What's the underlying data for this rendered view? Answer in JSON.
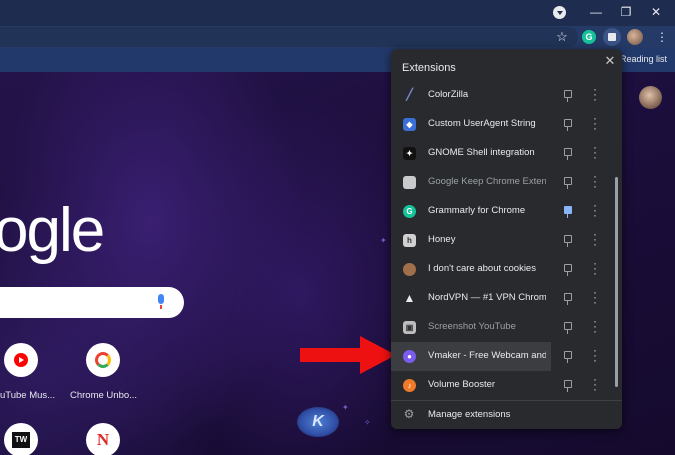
{
  "browser": {
    "window_controls": {
      "minimize": "—",
      "restore": "❐",
      "close": "✕"
    },
    "toolbar": {
      "bookmark_star": "☆",
      "menu": "⋮"
    },
    "extension_button_letter": "G",
    "bookmarks_bar": {
      "reading_list": "Reading list"
    }
  },
  "new_tab_page": {
    "logo_text": "ogle",
    "shortcuts": [
      {
        "label": "uTube Mus...",
        "icon": "youtube-music-icon"
      },
      {
        "label": "Chrome Unbo...",
        "icon": "chrome-icon"
      },
      {
        "label": "",
        "icon": "tw-icon",
        "text": "TW"
      },
      {
        "label": "",
        "icon": "news-icon",
        "text": "N"
      }
    ]
  },
  "extensions_popup": {
    "title": "Extensions",
    "close_icon": "✕",
    "items": [
      {
        "name": "ColorZilla",
        "icon": "colorzilla-icon",
        "icon_color": "#7a8ad6",
        "pinned": false,
        "dim": false
      },
      {
        "name": "Custom UserAgent String",
        "icon": "useragent-icon",
        "icon_color": "#3b6fd8",
        "pinned": false,
        "dim": false
      },
      {
        "name": "GNOME Shell integration",
        "icon": "gnome-icon",
        "icon_color": "#111111",
        "pinned": false,
        "dim": false
      },
      {
        "name": "Google Keep Chrome Exten...",
        "icon": "google-keep-icon",
        "icon_color": "#c9cacc",
        "pinned": false,
        "dim": true
      },
      {
        "name": "Grammarly for Chrome",
        "icon": "grammarly-icon",
        "icon_color": "#15c39a",
        "pinned": true,
        "dim": false
      },
      {
        "name": "Honey",
        "icon": "honey-icon",
        "icon_color": "#d0d0d0",
        "pinned": false,
        "dim": false
      },
      {
        "name": "I don't care about cookies",
        "icon": "cookie-icon",
        "icon_color": "#a0704a",
        "pinned": false,
        "dim": false
      },
      {
        "name": "NordVPN — #1 VPN Chrom...",
        "icon": "nordvpn-icon",
        "icon_color": "#e8eaed",
        "pinned": false,
        "dim": false
      },
      {
        "name": "Screenshot YouTube",
        "icon": "screenshot-icon",
        "icon_color": "#bdbdbd",
        "pinned": false,
        "dim": true
      },
      {
        "name": "Vmaker - Free Webcam and...",
        "icon": "vmaker-icon",
        "icon_color": "#7b5cf0",
        "pinned": false,
        "dim": false,
        "highlighted": true
      },
      {
        "name": "Volume Booster",
        "icon": "volume-booster-icon",
        "icon_color": "#f07a2a",
        "pinned": false,
        "dim": false
      }
    ],
    "manage_label": "Manage extensions",
    "more_icon": "⋮"
  }
}
